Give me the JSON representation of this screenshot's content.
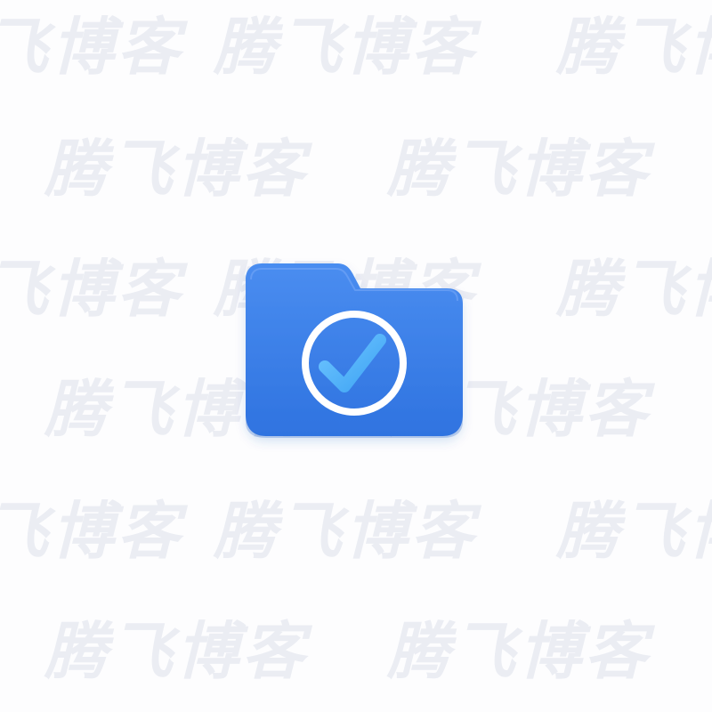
{
  "watermark": {
    "text": "腾飞博客",
    "color": "#e8ebf2"
  },
  "icon": {
    "name": "folder-check-icon",
    "folder_color": "#2f73e0",
    "folder_highlight": "#4a8df0",
    "ring_color": "#ffffff",
    "check_color": "#3fa4f4"
  }
}
